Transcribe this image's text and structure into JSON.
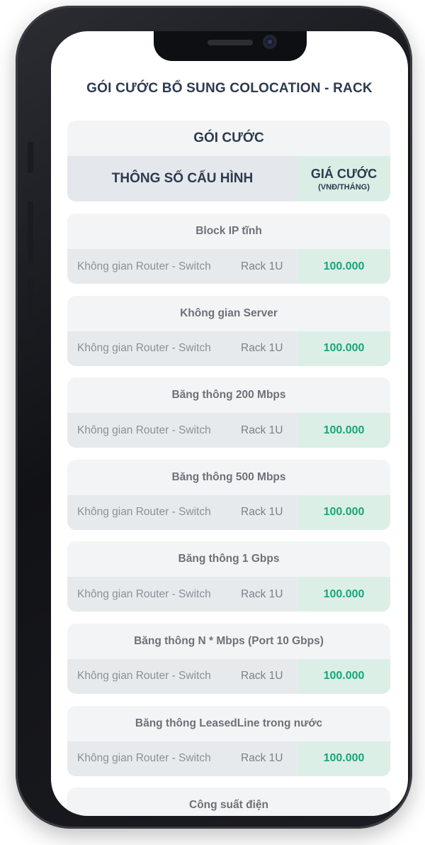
{
  "page": {
    "title": "GÓI CƯỚC BỔ SUNG COLOCATION - RACK"
  },
  "table_header": {
    "group_label": "GÓI CƯỚC",
    "config_label": "THÔNG SỐ CẤU HÌNH",
    "price_label": "GIÁ CƯỚC",
    "price_unit": "(VNĐ/THÁNG)"
  },
  "items": [
    {
      "title": "Block IP tĩnh",
      "spec": "Không gian Router - Switch",
      "rack": "Rack 1U",
      "price": "100.000"
    },
    {
      "title": "Không gian Server",
      "spec": "Không gian Router - Switch",
      "rack": "Rack 1U",
      "price": "100.000"
    },
    {
      "title": "Băng thông 200 Mbps",
      "spec": "Không gian Router - Switch",
      "rack": "Rack 1U",
      "price": "100.000"
    },
    {
      "title": "Băng thông 500 Mbps",
      "spec": "Không gian Router - Switch",
      "rack": "Rack 1U",
      "price": "100.000"
    },
    {
      "title": "Băng thông 1 Gbps",
      "spec": "Không gian Router - Switch",
      "rack": "Rack 1U",
      "price": "100.000"
    },
    {
      "title": "Băng thông N * Mbps (Port 10 Gbps)",
      "spec": "Không gian Router - Switch",
      "rack": "Rack 1U",
      "price": "100.000"
    },
    {
      "title": "Băng thông LeasedLine trong nước",
      "spec": "Không gian Router - Switch",
      "rack": "Rack 1U",
      "price": "100.000"
    },
    {
      "title": "Công suất điện",
      "spec": "",
      "rack": "",
      "price": ""
    }
  ],
  "colors": {
    "price_accent": "#17a679",
    "title_text": "#2c3a4f",
    "card_bg": "#f3f4f5",
    "price_cell_bg": "#dcefe7"
  }
}
